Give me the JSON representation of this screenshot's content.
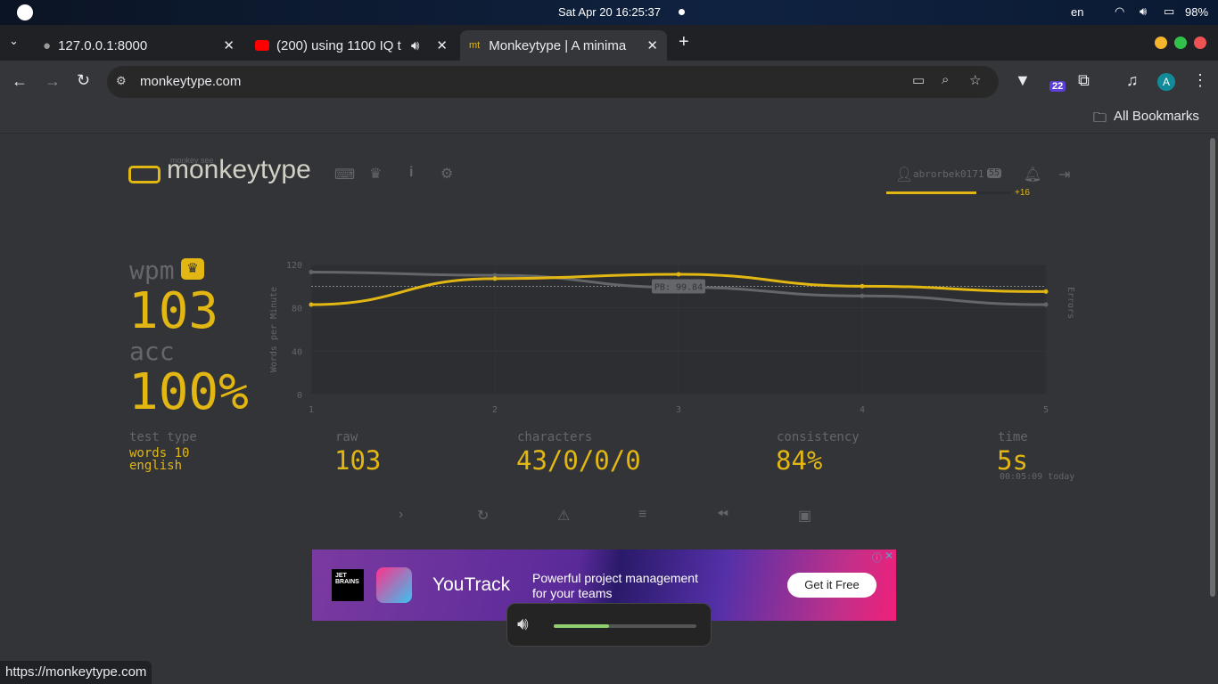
{
  "os": {
    "datetime": "Sat Apr 20  16:25:37",
    "lang": "en",
    "battery": "98%"
  },
  "tabs": [
    {
      "title": "127.0.0.1:8000"
    },
    {
      "title": "(200) using 1100 IQ t"
    },
    {
      "title": "Monkeytype | A minima"
    }
  ],
  "address": {
    "url": "monkeytype.com"
  },
  "extension_badge": "22",
  "profile_initial": "A",
  "bookmarks": {
    "label": "All Bookmarks"
  },
  "header": {
    "tagline": "monkey see",
    "logo_text": "monkeytype",
    "username": "abrorbek0171",
    "level": "55",
    "xp_gain": "+16",
    "xp_progress": 0.72
  },
  "result": {
    "wpm_label": "wpm",
    "wpm": "103",
    "acc_label": "acc",
    "acc": "100%",
    "test_type_label": "test type",
    "test_type_1": "words 10",
    "test_type_2": "english",
    "raw_label": "raw",
    "raw": "103",
    "characters_label": "characters",
    "characters": "43/0/0/0",
    "consistency_label": "consistency",
    "consistency": "84%",
    "time_label": "time",
    "time": "5s",
    "time_detail": "00:05:09 today"
  },
  "chart_data": {
    "type": "line",
    "x": [
      1,
      2,
      3,
      4,
      5
    ],
    "series": [
      {
        "name": "wpm",
        "color": "#e2b714",
        "values": [
          83,
          107,
          111,
          100,
          95
        ]
      },
      {
        "name": "raw",
        "color": "#646669",
        "values": [
          113,
          110,
          99,
          91,
          83
        ]
      }
    ],
    "pb": {
      "label": "PB: 99.84",
      "value": 99.84
    },
    "ylabel": "Words per Minute",
    "y2label": "Errors",
    "ylim": [
      0,
      120
    ],
    "yticks": [
      "0",
      "40",
      "80",
      "120"
    ],
    "xticks": [
      "1",
      "2",
      "3",
      "4",
      "5"
    ]
  },
  "ad": {
    "brand": "JET BRAINS",
    "product": "YouTrack",
    "line1": "Powerful project management",
    "line2": "for your teams",
    "cta": "Get it Free"
  },
  "volume": {
    "level": 0.39
  },
  "status_url": "https://monkeytype.com"
}
